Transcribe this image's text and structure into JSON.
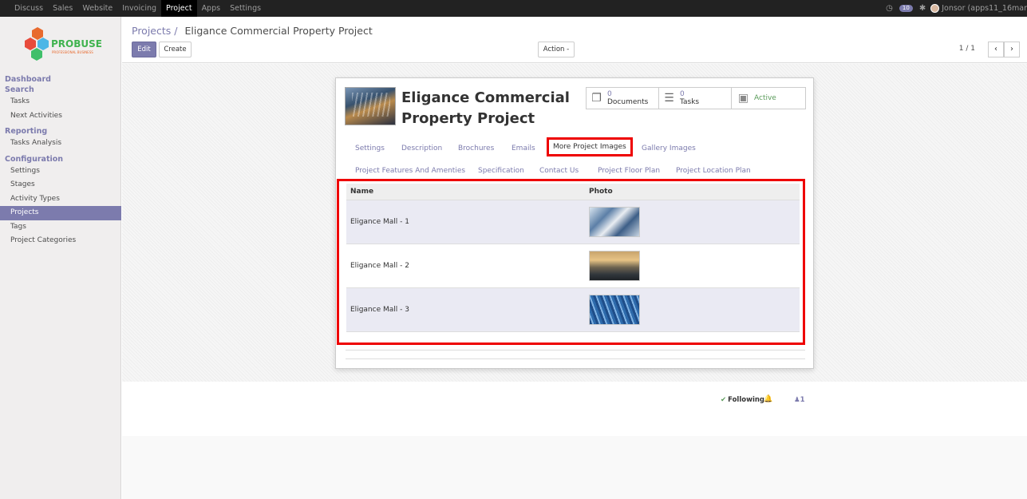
{
  "topbar": {
    "menu": [
      "Discuss",
      "Sales",
      "Website",
      "Invoicing",
      "Project",
      "Apps",
      "Settings"
    ],
    "active_index": 4,
    "badge": "10",
    "user": "Jonsor (apps11_16mar"
  },
  "logo": {
    "text": "PROBUSE",
    "tagline": "PROFESSIONAL BUSINESS"
  },
  "sidebar": {
    "dashboard": "Dashboard",
    "search": "Search",
    "tasks": "Tasks",
    "next_activities": "Next Activities",
    "reporting": "Reporting",
    "tasks_analysis": "Tasks Analysis",
    "configuration": "Configuration",
    "settings": "Settings",
    "stages": "Stages",
    "activity_types": "Activity Types",
    "projects": "Projects",
    "tags": "Tags",
    "project_categories": "Project Categories"
  },
  "breadcrumb": {
    "parent": "Projects",
    "sep": "/",
    "current": "Eligance Commercial Property Project"
  },
  "buttons": {
    "edit": "Edit",
    "create": "Create",
    "action": "Action -"
  },
  "pager": {
    "text": "1 / 1"
  },
  "record": {
    "title_line1": "Eligance Commercial",
    "title_line2": "Property Project",
    "smart_buttons": {
      "documents_count": "0",
      "documents_label": "Documents",
      "tasks_count": "0",
      "tasks_label": "Tasks",
      "active_label": "Active"
    }
  },
  "tabs": {
    "settings": "Settings",
    "description": "Description",
    "brochures": "Brochures",
    "emails": "Emails",
    "more_images": "More Project Images",
    "gallery": "Gallery Images",
    "features": "Project Features And Amenties",
    "specification": "Specification",
    "contact": "Contact Us",
    "floor_plan": "Project Floor Plan",
    "location_plan": "Project Location Plan"
  },
  "table": {
    "headers": {
      "name": "Name",
      "photo": "Photo"
    },
    "rows": [
      {
        "name": "Eligance Mall - 1"
      },
      {
        "name": "Eligance Mall - 2"
      },
      {
        "name": "Eligance Mall - 3"
      }
    ]
  },
  "chatter": {
    "following": "Following",
    "followers": "1"
  },
  "colors": {
    "accent": "#7c7bad",
    "highlight": "#e00000",
    "active_green": "#5a9b5a"
  }
}
